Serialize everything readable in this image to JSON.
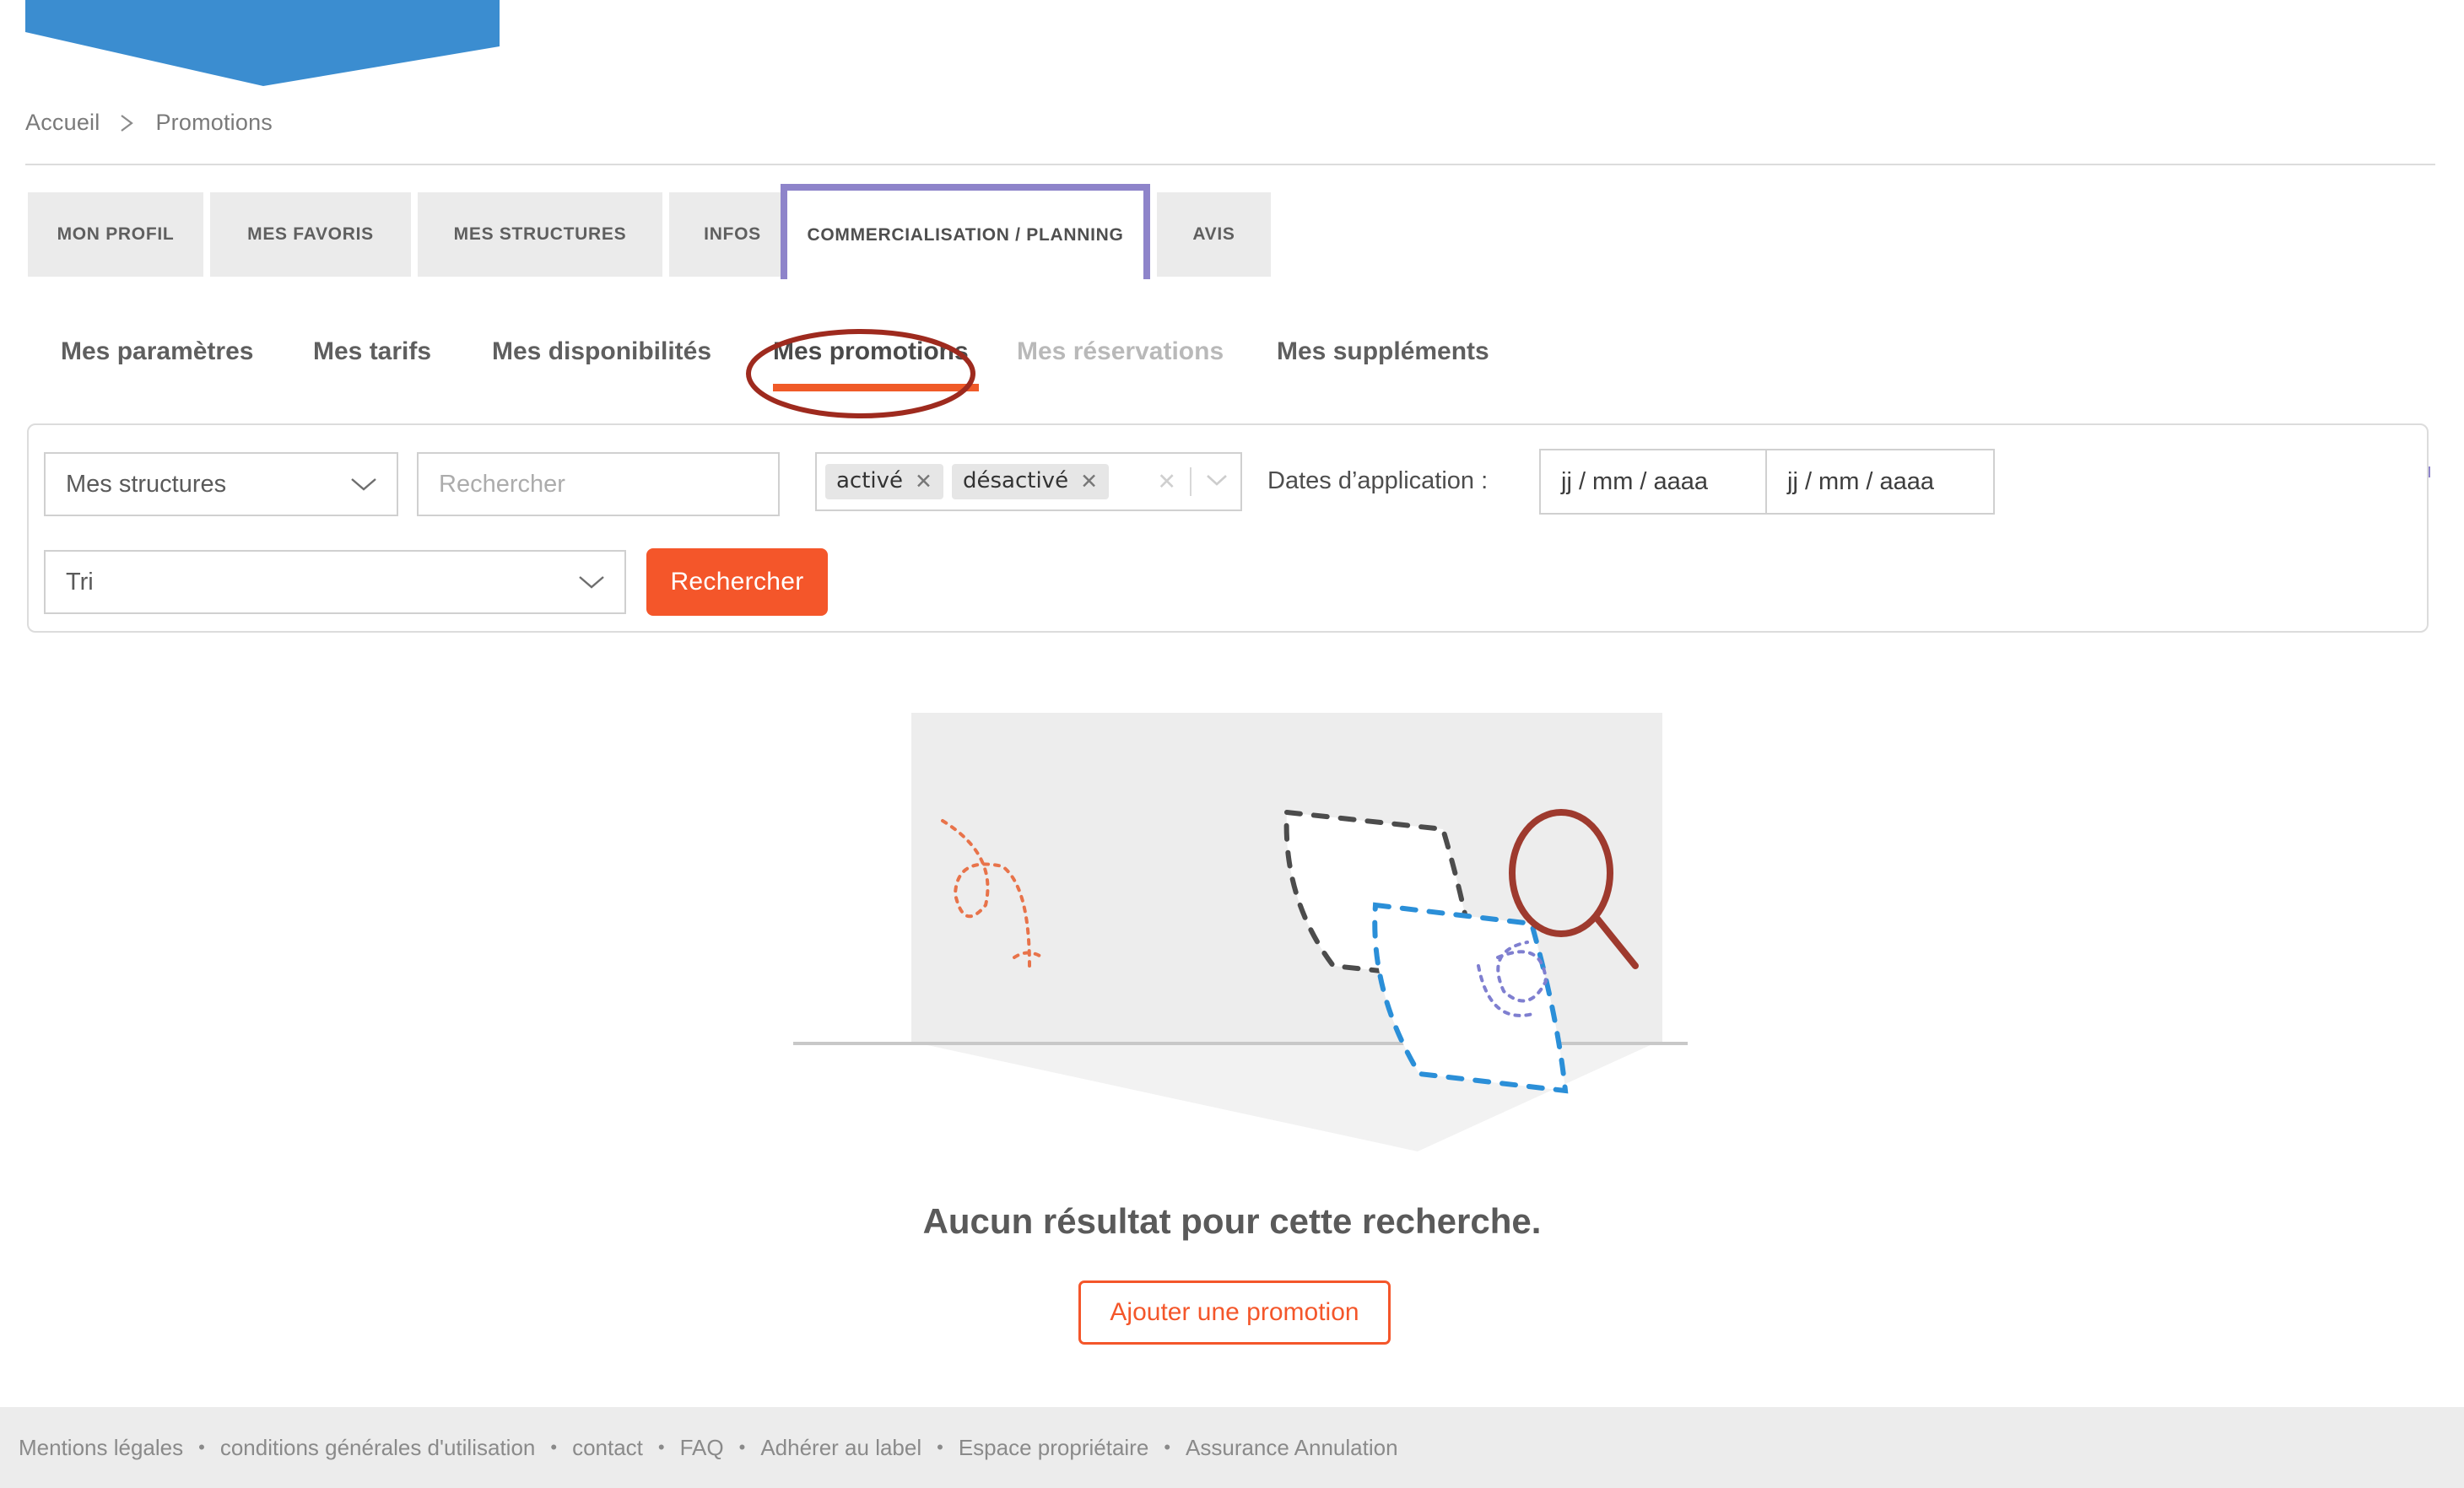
{
  "brand": {
    "banner_color": "#3b8dd0",
    "accent_orange": "#f4562a",
    "accent_purple": "#8e84ca",
    "annotation_red": "#9e2a1e"
  },
  "breadcrumb": {
    "items": [
      "Accueil",
      "Promotions"
    ],
    "separator_icon": "chevron-right-icon"
  },
  "tabs": [
    {
      "label": "MON PROFIL",
      "active": false
    },
    {
      "label": "MES FAVORIS",
      "active": false
    },
    {
      "label": "MES STRUCTURES",
      "active": false
    },
    {
      "label": "INFOS",
      "active": false
    },
    {
      "label": "COMMERCIALISATION / PLANNING",
      "active": true
    },
    {
      "label": "AVIS",
      "active": false
    }
  ],
  "subnav": [
    {
      "label": "Mes paramètres",
      "state": "normal"
    },
    {
      "label": "Mes tarifs",
      "state": "normal"
    },
    {
      "label": "Mes disponibilités",
      "state": "normal"
    },
    {
      "label": "Mes promotions",
      "state": "current"
    },
    {
      "label": "Mes réservations",
      "state": "disabled"
    },
    {
      "label": "Mes suppléments",
      "state": "normal"
    }
  ],
  "filters": {
    "structures_select": {
      "value": "Mes structures",
      "chevron_icon": "chevron-down-icon"
    },
    "search_input": {
      "value": "",
      "placeholder": "Rechercher"
    },
    "status_multiselect": {
      "chips": [
        "activé",
        "désactivé"
      ],
      "chip_remove_icon": "close-icon",
      "clear_all_icon": "clear-icon",
      "chevron_icon": "chevron-down-icon"
    },
    "dates_label": "Dates d’application :",
    "date_from": {
      "value": "",
      "placeholder": "jj / mm / aaaa"
    },
    "date_to": {
      "value": "",
      "placeholder": "jj / mm / aaaa"
    },
    "sort_select": {
      "value": "Tri",
      "chevron_icon": "chevron-down-icon"
    },
    "search_button": "Rechercher"
  },
  "empty_state": {
    "illustration": "no-results-illustration",
    "title": "Aucun résultat pour cette recherche.",
    "cta_label": "Ajouter une promotion"
  },
  "footer": {
    "links": [
      "Mentions légales",
      "conditions générales d'utilisation",
      "contact",
      "FAQ",
      "Adhérer au label",
      "Espace propriétaire",
      "Assurance Annulation"
    ],
    "separator": "•"
  }
}
